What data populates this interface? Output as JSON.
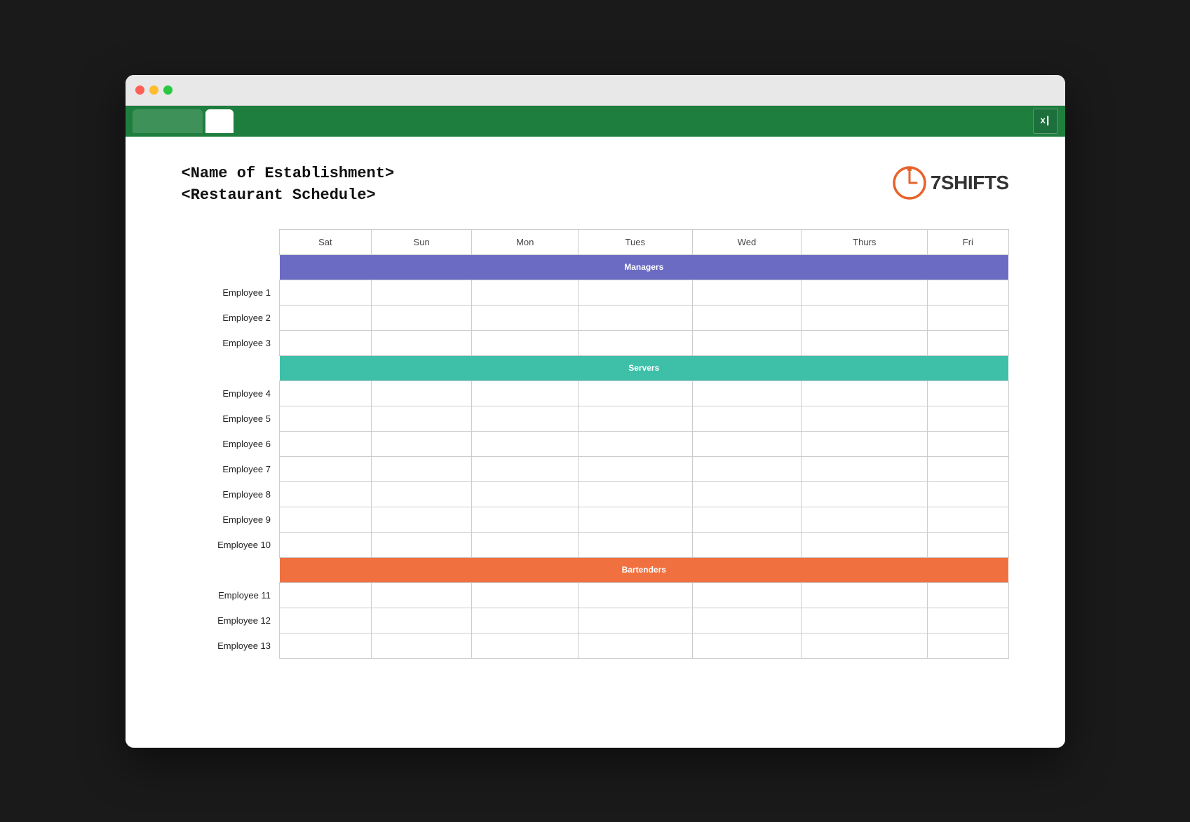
{
  "browser": {
    "traffic_lights": [
      "red",
      "yellow",
      "green"
    ],
    "tab_label": "",
    "excel_icon_label": "X"
  },
  "document": {
    "establishment_name": "<Name of Establishment>",
    "schedule_title": "<Restaurant Schedule>"
  },
  "logo": {
    "brand_name": "7SHIFTS"
  },
  "table": {
    "columns": [
      "Sat",
      "Sun",
      "Mon",
      "Tues",
      "Wed",
      "Thurs",
      "Fri"
    ],
    "sections": [
      {
        "name": "Managers",
        "color": "managers",
        "employees": [
          "Employee 1",
          "Employee 2",
          "Employee 3"
        ]
      },
      {
        "name": "Servers",
        "color": "servers",
        "employees": [
          "Employee 4",
          "Employee 5",
          "Employee 6",
          "Employee 7",
          "Employee 8",
          "Employee 9",
          "Employee 10"
        ]
      },
      {
        "name": "Bartenders",
        "color": "bartenders",
        "employees": [
          "Employee 11",
          "Employee 12",
          "Employee 13"
        ]
      }
    ]
  }
}
